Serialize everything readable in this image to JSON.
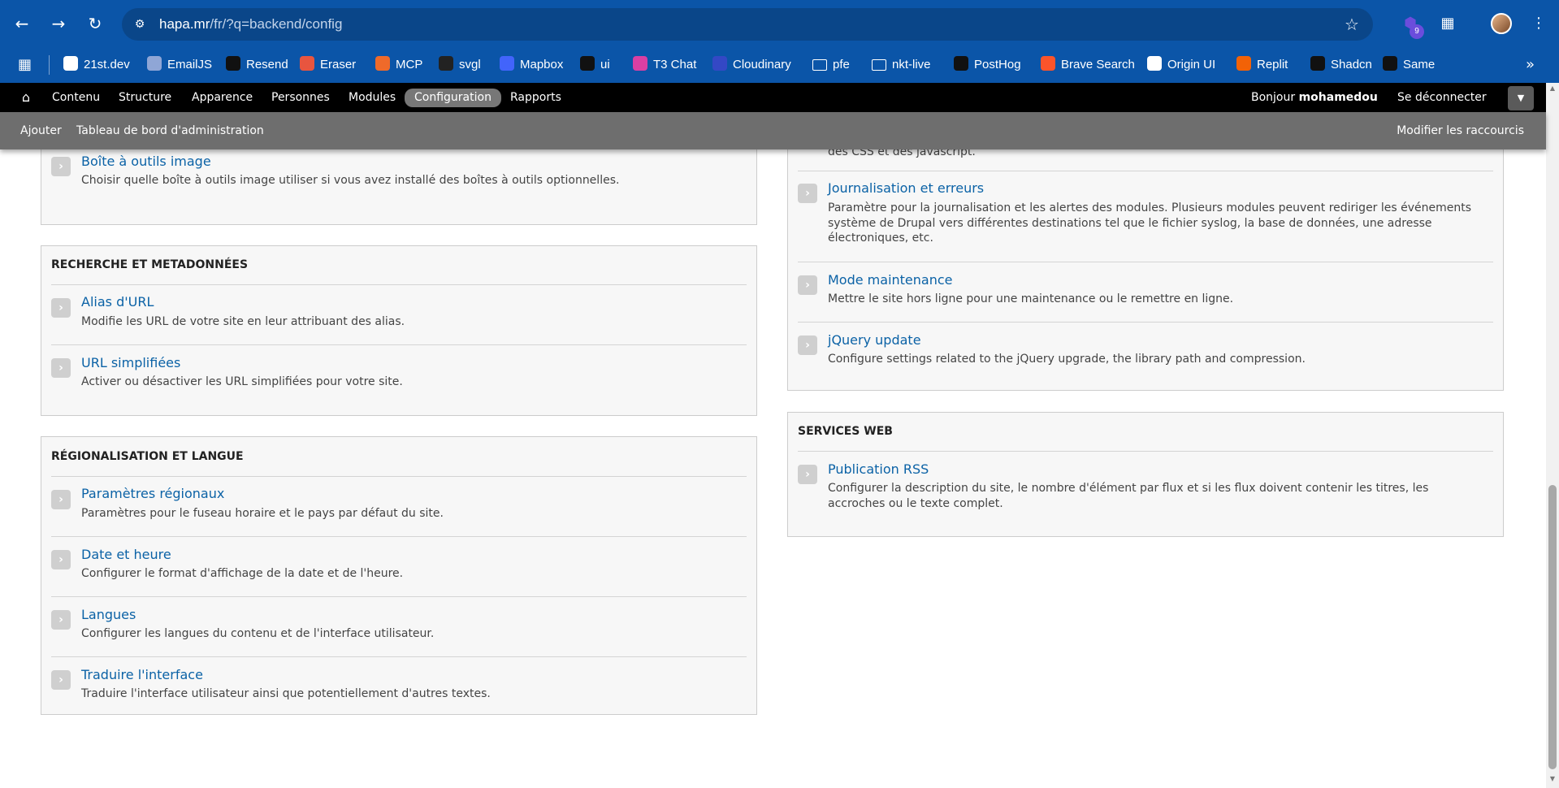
{
  "browser": {
    "url_host": "hapa.mr",
    "url_path": "/fr/?q=backend/config",
    "extension_badge": "9",
    "bookmarks": [
      {
        "label": "21st.dev",
        "icon": "21st-icon",
        "color": "#ffffff"
      },
      {
        "label": "EmailJS",
        "icon": "emailjs-icon",
        "color": "#8fa6d6"
      },
      {
        "label": "Resend",
        "icon": "resend-icon",
        "color": "#111111"
      },
      {
        "label": "Eraser",
        "icon": "eraser-icon",
        "color": "#e8553f"
      },
      {
        "label": "MCP",
        "icon": "mcp-icon",
        "color": "#ef6a2a"
      },
      {
        "label": "svgl",
        "icon": "svgl-icon",
        "color": "#222222"
      },
      {
        "label": "Mapbox",
        "icon": "mapbox-icon",
        "color": "#4264fb"
      },
      {
        "label": "ui",
        "icon": "ui-icon",
        "color": "#111111"
      },
      {
        "label": "T3 Chat",
        "icon": "t3chat-icon",
        "color": "#d93fa3"
      },
      {
        "label": "Cloudinary",
        "icon": "cloudinary-icon",
        "color": "#3448c5"
      },
      {
        "label": "pfe",
        "icon": "folder-icon",
        "color": "transparent"
      },
      {
        "label": "nkt-live",
        "icon": "folder-icon",
        "color": "transparent"
      },
      {
        "label": "PostHog",
        "icon": "posthog-icon",
        "color": "#111111"
      },
      {
        "label": "Brave Search",
        "icon": "brave-icon",
        "color": "#fb542b"
      },
      {
        "label": "Origin UI",
        "icon": "originui-icon",
        "color": "#ffffff"
      },
      {
        "label": "Replit",
        "icon": "replit-icon",
        "color": "#f26207"
      },
      {
        "label": "Shadcn",
        "icon": "shadcn-icon",
        "color": "#111111"
      },
      {
        "label": "Same",
        "icon": "same-icon",
        "color": "#111111"
      }
    ]
  },
  "toolbar": {
    "menu": [
      "Contenu",
      "Structure",
      "Apparence",
      "Personnes",
      "Modules",
      "Configuration",
      "Rapports"
    ],
    "active": "Configuration",
    "greeting_prefix": "Bonjour ",
    "username": "mohamedou",
    "logout": "Se déconnecter"
  },
  "shortcuts": {
    "add": "Ajouter",
    "dashboard": "Tableau de bord d'administration",
    "edit": "Modifier les raccourcis"
  },
  "left_column": {
    "top_panel": {
      "entries": [
        {
          "link": "Boîte à outils image",
          "desc": "Choisir quelle boîte à outils image utiliser si vous avez installé des boîtes à outils optionnelles."
        }
      ]
    },
    "search_panel": {
      "title": "RECHERCHE ET METADONNÉES",
      "entries": [
        {
          "link": "Alias d'URL",
          "desc": "Modifie les URL de votre site en leur attribuant des alias."
        },
        {
          "link": "URL simplifiées",
          "desc": "Activer ou désactiver les URL simplifiées pour votre site."
        }
      ]
    },
    "region_panel": {
      "title": "RÉGIONALISATION ET LANGUE",
      "entries": [
        {
          "link": "Paramètres régionaux",
          "desc": "Paramètres pour le fuseau horaire et le pays par défaut du site."
        },
        {
          "link": "Date et heure",
          "desc": "Configurer le format d'affichage de la date et de l'heure."
        },
        {
          "link": "Langues",
          "desc": "Configurer les langues du contenu et de l'interface utilisateur."
        },
        {
          "link": "Traduire l'interface",
          "desc": "Traduire l'interface utilisateur ainsi que potentiellement d'autres textes."
        }
      ]
    }
  },
  "right_column": {
    "dev_panel": {
      "clipped_text": "des CSS et des javascript.",
      "entries": [
        {
          "link": "Journalisation et erreurs",
          "desc": "Paramètre pour la journalisation et les alertes des modules. Plusieurs modules peuvent rediriger les événements système de Drupal vers différentes destinations tel que le fichier syslog, la base de données, une adresse électroniques, etc."
        },
        {
          "link": "Mode maintenance",
          "desc": "Mettre le site hors ligne pour une maintenance ou le remettre en ligne."
        },
        {
          "link": "jQuery update",
          "desc": "Configure settings related to the jQuery upgrade, the library path and compression."
        }
      ]
    },
    "web_panel": {
      "title": "SERVICES WEB",
      "entries": [
        {
          "link": "Publication RSS",
          "desc": "Configurer la description du site, le nombre d'élément par flux et si les flux doivent contenir les titres, les accroches ou le texte complet."
        }
      ]
    }
  }
}
